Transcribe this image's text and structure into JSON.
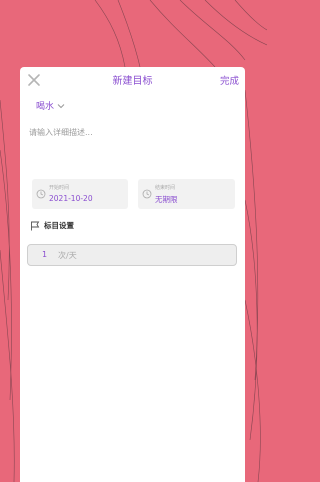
{
  "header": {
    "title": "新建目标",
    "done_label": "完成",
    "close_icon": "close-icon"
  },
  "category": {
    "value": "喝水",
    "icon": "chevron-down-icon"
  },
  "description": {
    "placeholder": "请输入详细描述..."
  },
  "dates": {
    "start_label": "开始时间",
    "start_value": "2021-10-20",
    "end_label": "结束时间",
    "end_value": "无期限",
    "icon": "clock-icon"
  },
  "target": {
    "section_label": "标目设置",
    "value": "1",
    "unit": "次/天",
    "icon": "flag-icon"
  },
  "colors": {
    "background": "#e8687a",
    "accent": "#8a4ed0",
    "card": "#ffffff"
  }
}
